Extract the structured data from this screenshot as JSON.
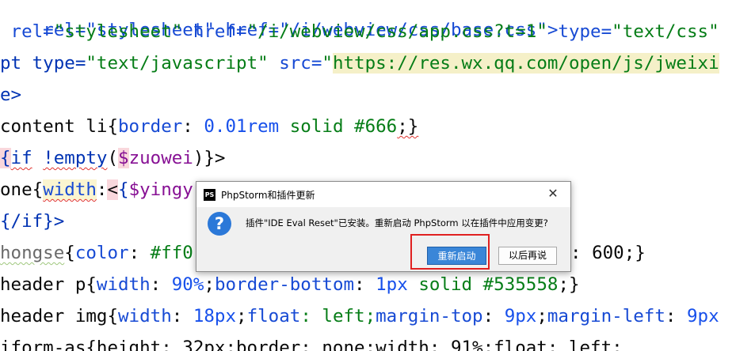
{
  "code_lines": {
    "l0": {
      "a": "rel=\"stylesheet\" href=\"/i/webview/css/base.css\">"
    },
    "l1": {
      "a": " rel=",
      "b": "\"stylesheet\"",
      "c": " href=",
      "d": "\"/i/webview/css/app.css?t=1\"",
      "e": " type=",
      "f": "\"text/css\""
    },
    "l2": {
      "a": "pt type=",
      "b": "\"text/javascript\"",
      "c": " src=",
      "d": "\"",
      "e": "https://res.wx.qq.com/open/js/jweixi"
    },
    "l3": {
      "a": "e>"
    },
    "l4": {
      "a": "content li",
      "b": "{",
      "c": "border",
      "d": ": ",
      "e": "0.01rem",
      "f": " solid ",
      "g": "#666",
      "h": ";}"
    },
    "l5": {
      "a": "{",
      "b": "if",
      "c": " ",
      "d": "!empty",
      "e": "(",
      "f": "$",
      "g": "zuowei",
      "h": ")}>"
    },
    "l6": {
      "a": "one{",
      "b": "width",
      "c": ":",
      "d": "<",
      "e": "{",
      "f": "$yingy"
    },
    "l7": {
      "a": "{/if}>"
    },
    "l8": {
      "a": "hongse",
      "b": "{",
      "c": "color",
      "d": ": ",
      "e": "#ff0",
      "f": ": 600;}"
    },
    "l9": {
      "a": "header p",
      "b": "{",
      "c": "width",
      "d": ": ",
      "e": "90",
      "f": "%",
      "g": ";",
      "h": "border-bottom",
      "i": ": ",
      "j": "1px",
      "k": " solid ",
      "l": "#535558",
      "m": ";}"
    },
    "l10": {
      "a": "header img",
      "b": "{",
      "c": "width",
      "d": ": ",
      "e": "18px",
      "f": ";",
      "g": "float",
      "h": ": left;",
      "i": "margin-top",
      "j": ": ",
      "k": "9px",
      "l": ";",
      "m": "margin-left",
      "n": ": ",
      "o": "9px"
    },
    "l11": {
      "a": "iform-as{height: 32px;border: none;width: 91%;float: left;"
    }
  },
  "dialog": {
    "title": "PhpStorm和插件更新",
    "app_icon_label": "PS",
    "close_symbol": "✕",
    "message": "插件\"IDE Eval Reset\"已安装。重新启动 PhpStorm 以在插件中应用变更?",
    "question_symbol": "?",
    "primary_button": "重新启动",
    "secondary_button": "以后再说"
  },
  "colors": {
    "highlight_box": "#e02020",
    "primary_button": "#3a86d8",
    "question_icon": "#2b78d8"
  }
}
